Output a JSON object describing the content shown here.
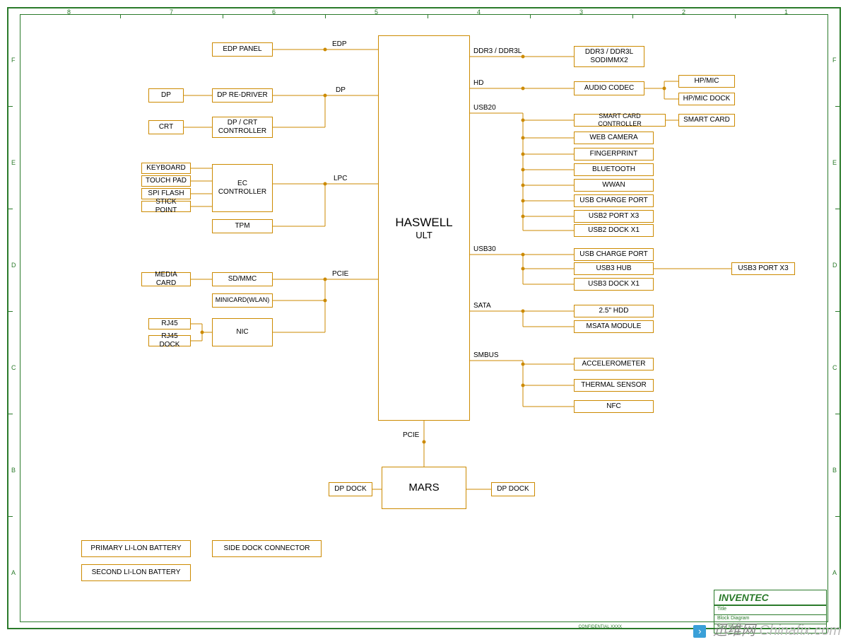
{
  "cpu": {
    "line1": "HASWELL",
    "line2": "ULT"
  },
  "mars": "MARS",
  "left_boxes": {
    "edp_panel": "EDP PANEL",
    "dp": "DP",
    "dp_redriver": "DP RE-DRIVER",
    "crt": "CRT",
    "dp_crt_ctrl": "DP / CRT\nCONTROLLER",
    "keyboard": "KEYBOARD",
    "touchpad": "TOUCH PAD",
    "spi_flash": "SPI FLASH",
    "stick_point": "STICK POINT",
    "ec_ctrl": "EC\nCONTROLLER",
    "tpm": "TPM",
    "media_card": "MEDIA CARD",
    "sd_mmc": "SD/MMC",
    "minicard_wlan": "MINICARD(WLAN)",
    "rj45": "RJ45",
    "rj45_dock": "RJ45 DOCK",
    "nic": "NIC"
  },
  "right_boxes": {
    "ddr_sodimm": "DDR3 / DDR3L\nSODIMMX2",
    "audio_codec": "AUDIO CODEC",
    "hp_mic": "HP/MIC",
    "hp_mic_dock": "HP/MIC DOCK",
    "smart_card_ctrl": "SMART CARD CONTROLLER",
    "smart_card": "SMART CARD",
    "web_camera": "WEB CAMERA",
    "fingerprint": "FINGERPRINT",
    "bluetooth": "BLUETOOTH",
    "wwan": "WWAN",
    "usb_charge_port": "USB CHARGE PORT",
    "usb2_port_x3": "USB2 PORT X3",
    "usb2_dock_x1": "USB2 DOCK X1",
    "usb3_charge_port": "USB CHARGE PORT",
    "usb3_hub": "USB3 HUB",
    "usb3_dock_x1": "USB3 DOCK X1",
    "usb3_port_x3": "USB3 PORT X3",
    "hdd_25": "2.5\" HDD",
    "msata": "MSATA MODULE",
    "accelerometer": "ACCELEROMETER",
    "thermal_sensor": "THERMAL SENSOR",
    "nfc": "NFC"
  },
  "bottom_boxes": {
    "dp_dock_left": "DP DOCK",
    "dp_dock_right": "DP DOCK",
    "primary_batt": "PRIMARY LI-LON BATTERY",
    "second_batt": "SECOND LI-LON BATTERY",
    "side_dock": "SIDE DOCK CONNECTOR"
  },
  "bus_labels": {
    "edp": "EDP",
    "dp": "DP",
    "lpc": "LPC",
    "pcie_left": "PCIE",
    "pcie_down": "PCIE",
    "ddr": "DDR3 / DDR3L",
    "hd": "HD",
    "usb20": "USB20",
    "usb30": "USB30",
    "sata": "SATA",
    "smbus": "SMBUS"
  },
  "title_block": {
    "company": "INVENTEC",
    "row1": "Title",
    "row2": "Block Diagram",
    "row3": "Size   Sheet"
  },
  "frame_strip": "CONFIDENTIAL  XXXX",
  "watermark_cn": "迅维网",
  "watermark_en": "Chinafix.com",
  "grid_cols": [
    "8",
    "7",
    "6",
    "5",
    "4",
    "3",
    "2",
    "1"
  ],
  "grid_rows": [
    "F",
    "E",
    "D",
    "C",
    "B",
    "A"
  ]
}
